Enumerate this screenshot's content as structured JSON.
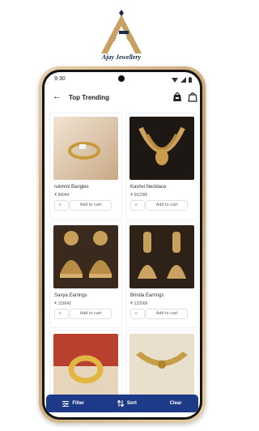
{
  "brand": {
    "name": "Ajay Jewellery",
    "logo_icon": "ajay-logo-icon"
  },
  "status_bar": {
    "time": "9:30"
  },
  "header": {
    "title": "Top Trending",
    "back_icon": "arrow-left-icon",
    "bag_icon": "shopping-bag-icon",
    "cart_icon": "lock-bag-icon"
  },
  "products": [
    {
      "name": "rukmini Bangles",
      "price": "₹ 84044",
      "add_label": "Add to cart",
      "image": "gold-ring"
    },
    {
      "name": "Kashvi Necklace",
      "price": "₹ 552285",
      "add_label": "Add to cart",
      "image": "gold-necklace"
    },
    {
      "name": "Savya Earrings",
      "price": "₹ 119942",
      "add_label": "Add to cart",
      "image": "gold-jhumka-earrings"
    },
    {
      "name": "Brinda Earrings",
      "price": "₹ 132069",
      "add_label": "Add to cart",
      "image": "gold-drop-earrings"
    },
    {
      "name": "",
      "price": "",
      "add_label": "",
      "image": "gold-bangles"
    },
    {
      "name": "",
      "price": "",
      "add_label": "",
      "image": "gold-choker"
    }
  ],
  "bottom_bar": {
    "filter_label": "Filter",
    "sort_label": "Sort",
    "clear_label": "Clear"
  },
  "colors": {
    "accent": "#1c3a87",
    "gold": "#c9a063",
    "brand_navy": "#1c2a4e"
  }
}
